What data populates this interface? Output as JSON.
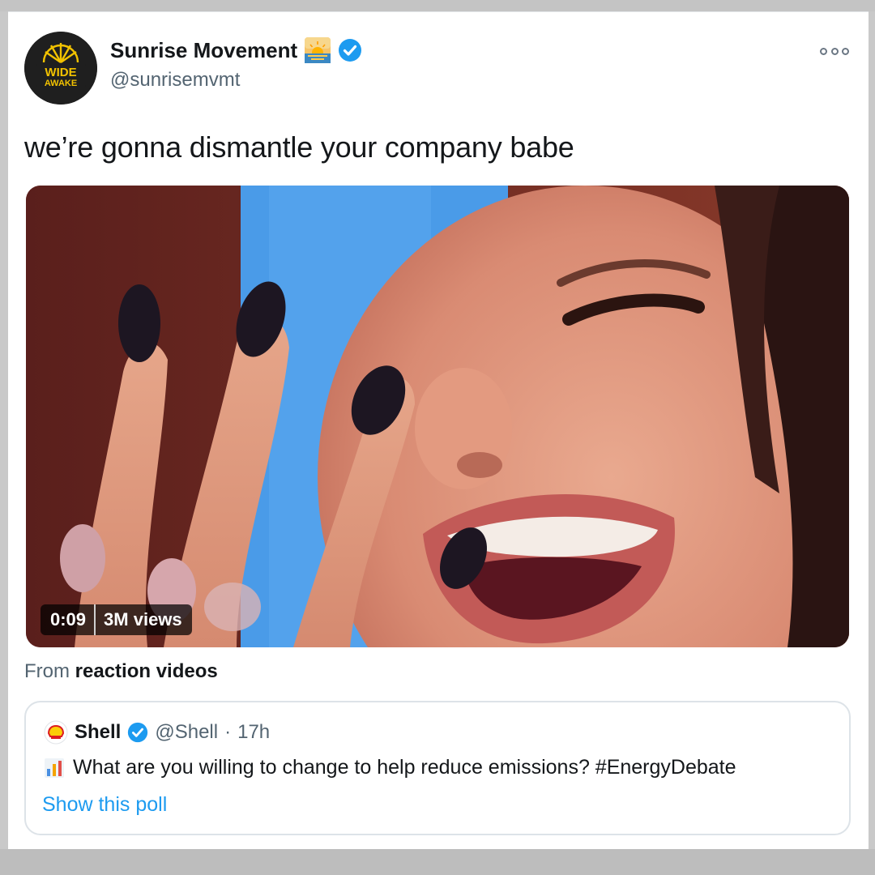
{
  "tweet": {
    "author": {
      "display_name": "Sunrise Movement",
      "handle": "@sunrisemvmt",
      "avatar_text_line1": "WIDE",
      "avatar_text_line2": "AWAKE",
      "verified": true,
      "name_emoji": "sunrise-emoji"
    },
    "text": "we’re gonna dismantle your company babe",
    "media": {
      "duration": "0:09",
      "views": "3M views"
    },
    "from": {
      "prefix": "From",
      "source": "reaction videos"
    },
    "quoted": {
      "author_name": "Shell",
      "verified": true,
      "handle": "@Shell",
      "separator": "·",
      "time": "17h",
      "text": "What are you willing to change to help reduce emissions? #EnergyDebate",
      "link": "Show this poll"
    }
  },
  "colors": {
    "link": "#1d9bf0",
    "verified": "#1d9bf0",
    "secondary_text": "#536471",
    "avatar_yellow": "#f2c200"
  }
}
